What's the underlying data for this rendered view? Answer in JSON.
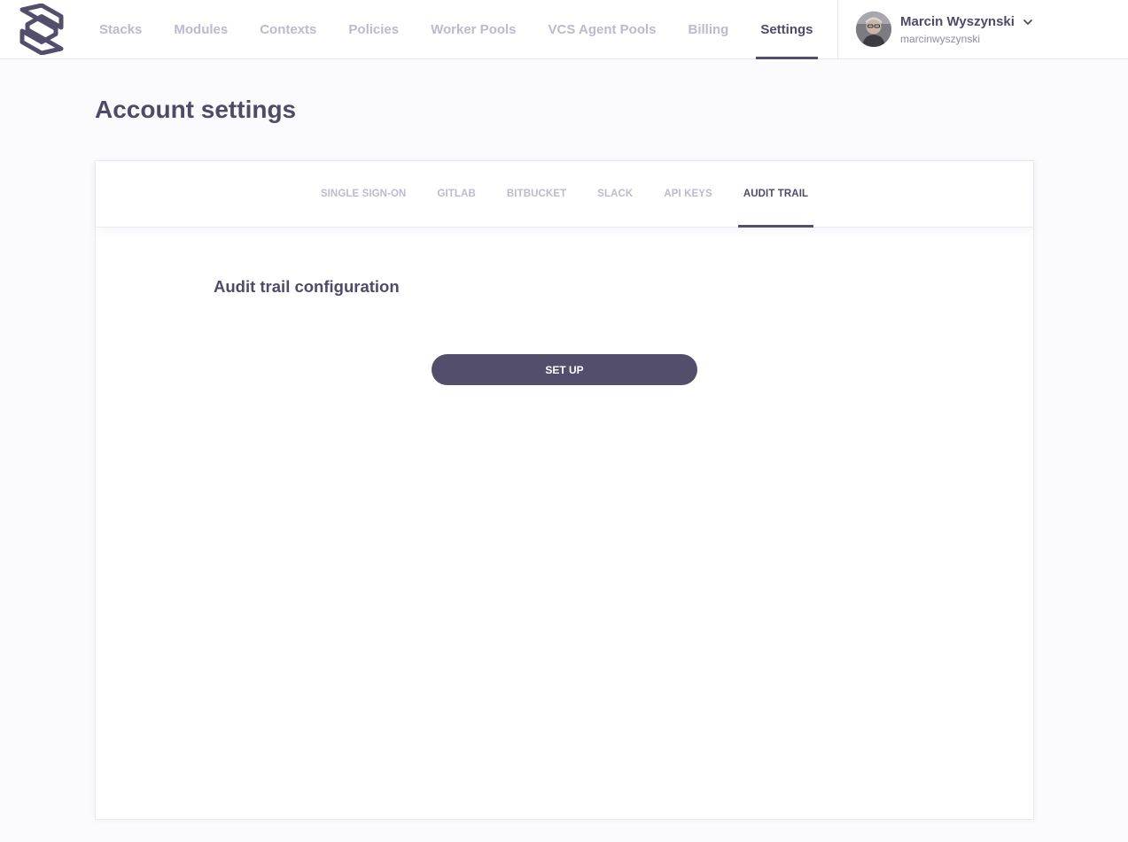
{
  "brand": {
    "logo_icon": "spacelift-logo-icon",
    "accent_color": "#524e6b"
  },
  "nav": {
    "items": [
      {
        "label": "Stacks"
      },
      {
        "label": "Modules"
      },
      {
        "label": "Contexts"
      },
      {
        "label": "Policies"
      },
      {
        "label": "Worker Pools"
      },
      {
        "label": "VCS Agent Pools"
      },
      {
        "label": "Billing"
      },
      {
        "label": "Settings",
        "active": true
      }
    ]
  },
  "user": {
    "name": "Marcin Wyszynski",
    "handle": "marcinwyszynski",
    "avatar_icon": "user-avatar",
    "menu_icon": "chevron-down-icon"
  },
  "page": {
    "title": "Account settings"
  },
  "tabs": {
    "items": [
      {
        "label": "SINGLE SIGN-ON"
      },
      {
        "label": "GITLAB"
      },
      {
        "label": "BITBUCKET"
      },
      {
        "label": "SLACK"
      },
      {
        "label": "API KEYS"
      },
      {
        "label": "AUDIT TRAIL",
        "active": true
      }
    ]
  },
  "audit_trail": {
    "title": "Audit trail configuration",
    "setup_label": "SET UP"
  }
}
